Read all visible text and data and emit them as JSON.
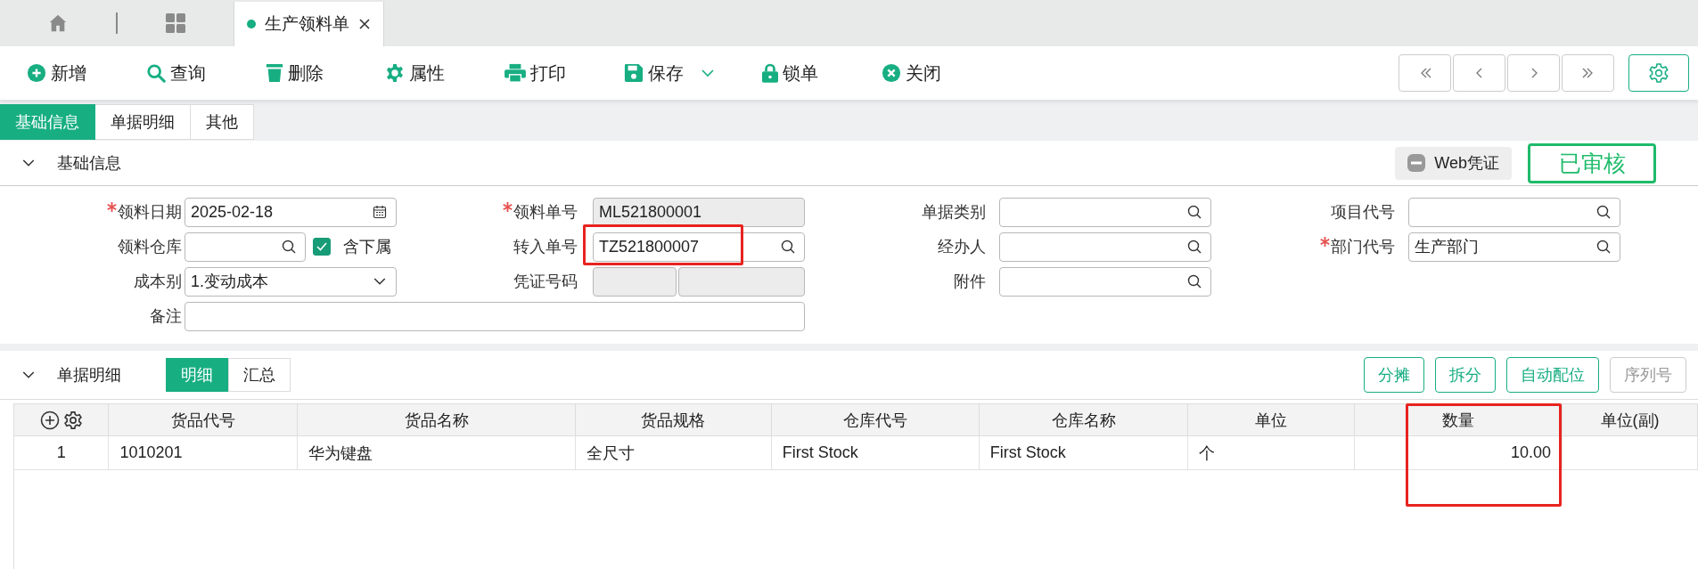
{
  "doc_tabs": [
    {
      "label": "生产领料单",
      "selected": true
    }
  ],
  "toolbar": {
    "buttons": [
      {
        "label": "新增",
        "kind": "add"
      },
      {
        "label": "查询",
        "kind": "search"
      },
      {
        "label": "删除",
        "kind": "delete"
      },
      {
        "label": "属性",
        "kind": "properties"
      },
      {
        "label": "打印",
        "kind": "print"
      },
      {
        "label": "保存",
        "kind": "save",
        "dropdown": true
      },
      {
        "label": "锁单",
        "kind": "lock"
      },
      {
        "label": "关闭",
        "kind": "close"
      }
    ]
  },
  "section_tabs": [
    {
      "label": "基础信息",
      "selected": true
    },
    {
      "label": "单据明细",
      "selected": false
    },
    {
      "label": "其他",
      "selected": false
    }
  ],
  "basic_info": {
    "title": "基础信息",
    "expanded": true,
    "voucher_button": "Web凭证",
    "status_stamp": "已审核",
    "rows": [
      [
        {
          "label": "领料日期",
          "required": true,
          "kind": "date",
          "value": "2025-02-18"
        },
        {
          "label": "领料单号",
          "required": true,
          "kind": "readonly",
          "value": "ML521800001"
        },
        {
          "label": "单据类别",
          "required": false,
          "kind": "lookup"
        },
        {
          "label": "项目代号",
          "required": false,
          "kind": "lookup"
        }
      ],
      [
        {
          "label": "领料仓库",
          "required": false,
          "kind": "lookup",
          "checkbox": {
            "label": "含下属",
            "checked": true
          }
        },
        {
          "label": "转入单号",
          "required": false,
          "kind": "lookup",
          "value": "TZ521800007",
          "highlighted": true
        },
        {
          "label": "经办人",
          "required": false,
          "kind": "lookup"
        },
        {
          "label": "部门代号",
          "required": true,
          "kind": "lookup",
          "value": "生产部门"
        }
      ],
      [
        {
          "label": "成本别",
          "required": false,
          "kind": "select",
          "value": "1.变动成本"
        },
        {
          "label": "凭证号码",
          "required": false,
          "kind": "split_readonly"
        },
        {
          "label": "附件",
          "required": false,
          "kind": "lookup"
        }
      ],
      [
        {
          "label": "备注",
          "required": false,
          "kind": "wide_text"
        }
      ]
    ]
  },
  "details": {
    "title": "单据明细",
    "expanded": true,
    "view_tabs": [
      {
        "label": "明细",
        "selected": true
      },
      {
        "label": "汇总",
        "selected": false
      }
    ],
    "actions": [
      {
        "label": "分摊",
        "disabled": false
      },
      {
        "label": "拆分",
        "disabled": false
      },
      {
        "label": "自动配位",
        "disabled": false
      },
      {
        "label": "序列号",
        "disabled": true
      }
    ],
    "table": {
      "columns": [
        {
          "label": "货品代号"
        },
        {
          "label": "货品名称"
        },
        {
          "label": "货品规格"
        },
        {
          "label": "仓库代号"
        },
        {
          "label": "仓库名称"
        },
        {
          "label": "单位"
        },
        {
          "label": "数量",
          "numeric": true,
          "highlighted": true
        },
        {
          "label": "单位(副)"
        }
      ],
      "rows": [
        {
          "index": "1",
          "cells": [
            "1010201",
            "华为键盘",
            "全尺寸",
            "First Stock",
            "First Stock",
            "个",
            "10.00"
          ]
        }
      ]
    }
  }
}
